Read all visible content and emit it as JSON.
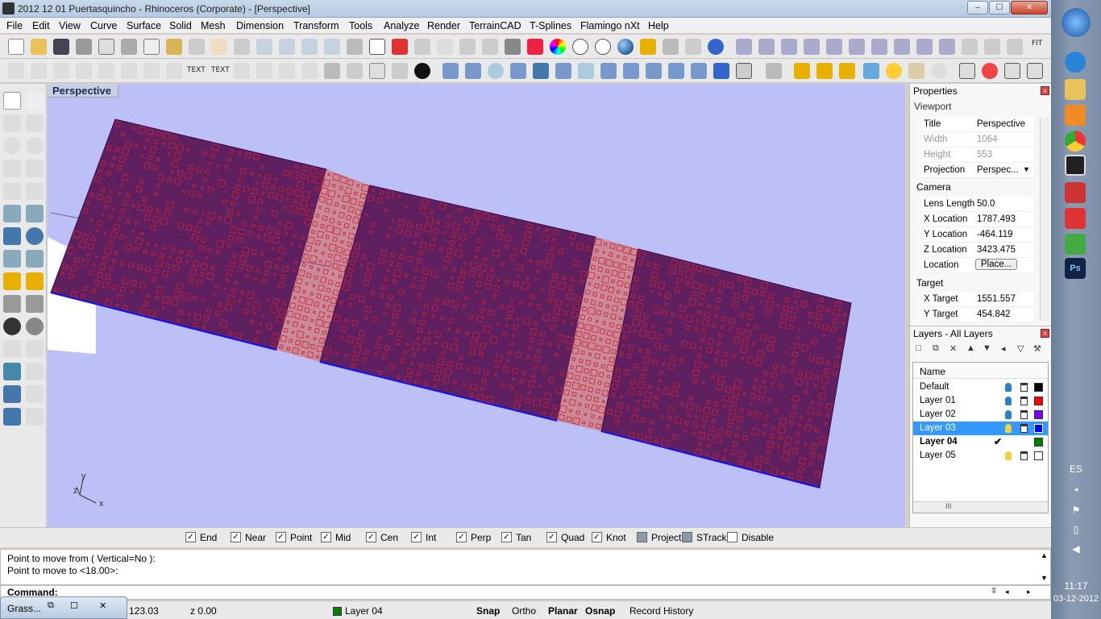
{
  "window": {
    "title": "2012 12 01 Puertasquincho - Rhinoceros (Corporate) - [Perspective]",
    "min": "‒",
    "max": "☐",
    "close": "✕"
  },
  "menu": [
    "File",
    "Edit",
    "View",
    "Curve",
    "Surface",
    "Solid",
    "Mesh",
    "Dimension",
    "Transform",
    "Tools",
    "Analyze",
    "Render",
    "TerrainCAD",
    "T-Splines",
    "Flamingo nXt",
    "Help"
  ],
  "toolbar_text": {
    "text1": "TEXT",
    "text2": "TEXT",
    "fit": "FIT"
  },
  "viewport": {
    "title": "Perspective",
    "axis_y": "y",
    "axis_z": "z",
    "axis_x": "x"
  },
  "properties": {
    "title": "Properties",
    "section_viewport": "Viewport",
    "rows": [
      {
        "label": "Title",
        "value": "Perspective"
      },
      {
        "label": "Width",
        "value": "1064"
      },
      {
        "label": "Height",
        "value": "553"
      },
      {
        "label": "Projection",
        "value": "Perspec..."
      }
    ],
    "section_camera": "Camera",
    "camera": [
      {
        "label": "Lens Length",
        "value": "50.0"
      },
      {
        "label": "X Location",
        "value": "1787.493"
      },
      {
        "label": "Y Location",
        "value": "-464.119"
      },
      {
        "label": "Z Location",
        "value": "3423.475"
      },
      {
        "label": "Location",
        "value": "Place..."
      }
    ],
    "section_target": "Target",
    "target": [
      {
        "label": "X Target",
        "value": "1551.557"
      },
      {
        "label": "Y Target",
        "value": "454.842"
      }
    ]
  },
  "layers": {
    "title": "Layers - All Layers",
    "column_name": "Name",
    "items": [
      {
        "name": "Default",
        "color": "#000000",
        "bulb": "blue"
      },
      {
        "name": "Layer 01",
        "color": "#ff0000",
        "bulb": "blue"
      },
      {
        "name": "Layer 02",
        "color": "#7f00ff",
        "bulb": "blue"
      },
      {
        "name": "Layer 03",
        "color": "#0000ff",
        "bulb": "yellow",
        "selected": true
      },
      {
        "name": "Layer 04",
        "color": "#008000",
        "current": true
      },
      {
        "name": "Layer 05",
        "color": "#ffffff",
        "bulb": "yellow"
      }
    ],
    "scroll_mid": "III"
  },
  "osnap": [
    {
      "label": "End",
      "checked": true
    },
    {
      "label": "Near",
      "checked": true
    },
    {
      "label": "Point",
      "checked": true
    },
    {
      "label": "Mid",
      "checked": true
    },
    {
      "label": "Cen",
      "checked": true
    },
    {
      "label": "Int",
      "checked": true
    },
    {
      "label": "Perp",
      "checked": true
    },
    {
      "label": "Tan",
      "checked": true
    },
    {
      "label": "Quad",
      "checked": true
    },
    {
      "label": "Knot",
      "checked": true
    },
    {
      "label": "Project",
      "checked": false
    },
    {
      "label": "STrack",
      "checked": false
    },
    {
      "label": "Disable",
      "checked": false
    }
  ],
  "command": {
    "history": [
      "Point to move from ( Vertical=No ):",
      "Point to move to <18.00>:"
    ],
    "prompt": "Command:"
  },
  "status": {
    "grass_tab": "Grass...",
    "coord_y": "123.03",
    "coord_z": "z 0.00",
    "layer": "Layer 04",
    "layer_color": "#008000",
    "snap": "Snap",
    "ortho": "Ortho",
    "planar": "Planar",
    "osnap": "Osnap",
    "record_history": "Record History"
  },
  "taskbar": {
    "lang": "ES",
    "time": "11:17",
    "date": "03-12-2012"
  }
}
